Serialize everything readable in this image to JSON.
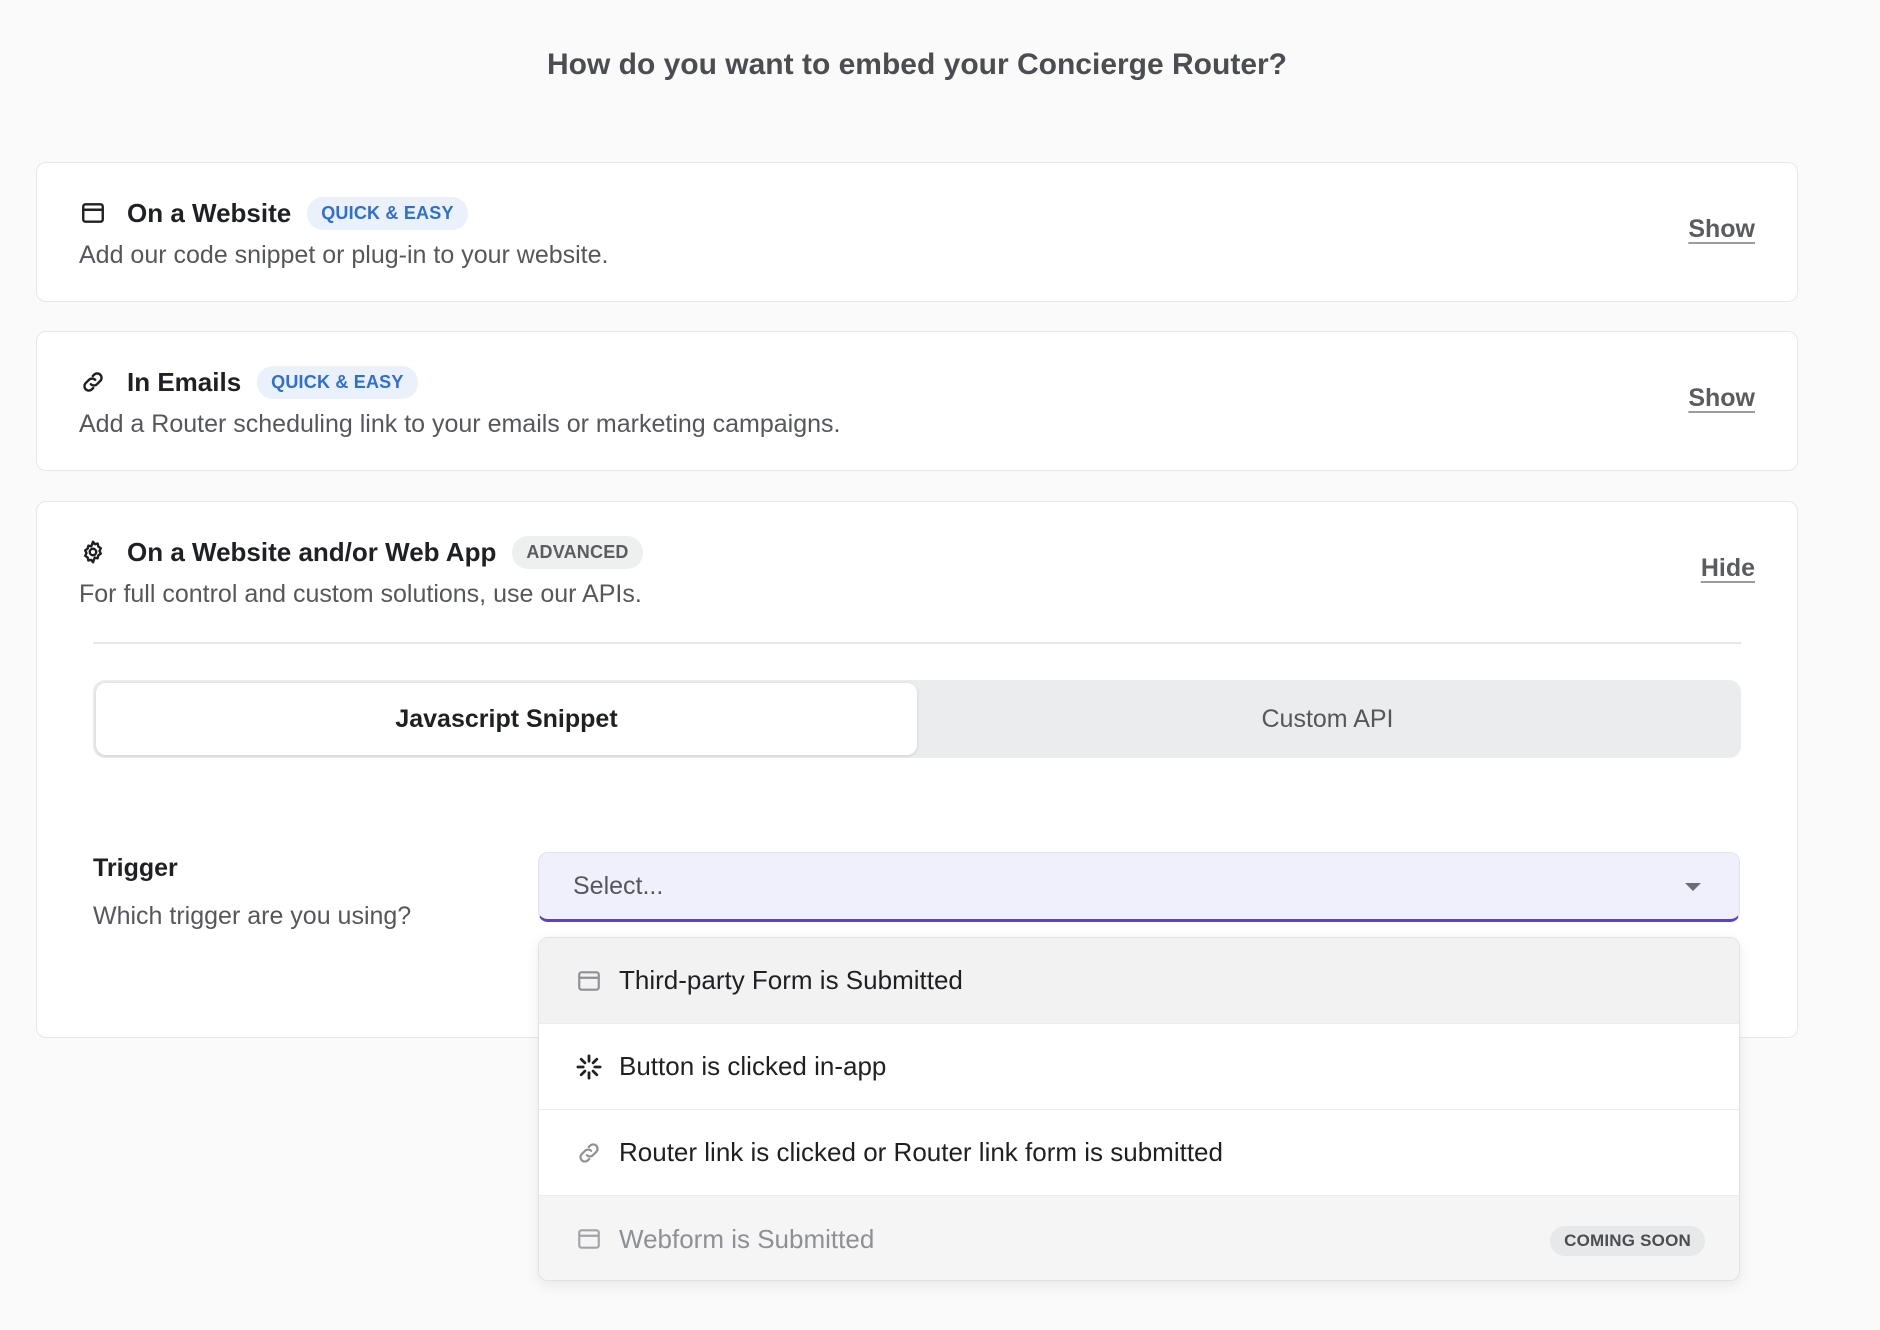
{
  "heading": "How do you want to embed your Concierge Router?",
  "cards": [
    {
      "title": "On a Website",
      "badge": "QUICK & EASY",
      "description": "Add our code snippet or plug-in to your website.",
      "toggle": "Show",
      "icon": "browser-window-icon"
    },
    {
      "title": "In Emails",
      "badge": "QUICK & EASY",
      "description": "Add a Router scheduling link to your emails or marketing campaigns.",
      "toggle": "Show",
      "icon": "link-icon"
    },
    {
      "title": "On a Website and/or Web App",
      "badge": "ADVANCED",
      "description": "For full control and custom solutions, use our APIs.",
      "toggle": "Hide",
      "icon": "gear-icon"
    }
  ],
  "tabs": [
    {
      "label": "Javascript Snippet",
      "active": true
    },
    {
      "label": "Custom API",
      "active": false
    }
  ],
  "trigger": {
    "label": "Trigger",
    "help": "Which trigger are you using?",
    "placeholder": "Select..."
  },
  "options": [
    {
      "label": "Third-party Form is Submitted",
      "icon": "browser-window-icon"
    },
    {
      "label": "Button is clicked in-app",
      "icon": "loader-icon"
    },
    {
      "label": "Router link is clicked or Router link form is submitted",
      "icon": "link-icon"
    },
    {
      "label": "Webform is Submitted",
      "icon": "browser-window-icon",
      "badge": "COMING SOON",
      "disabled": true
    }
  ],
  "colors": {
    "accent": "#5b3fd6",
    "badge_blue": "#2f6fd1",
    "select_bg": "#f0f0fc"
  }
}
